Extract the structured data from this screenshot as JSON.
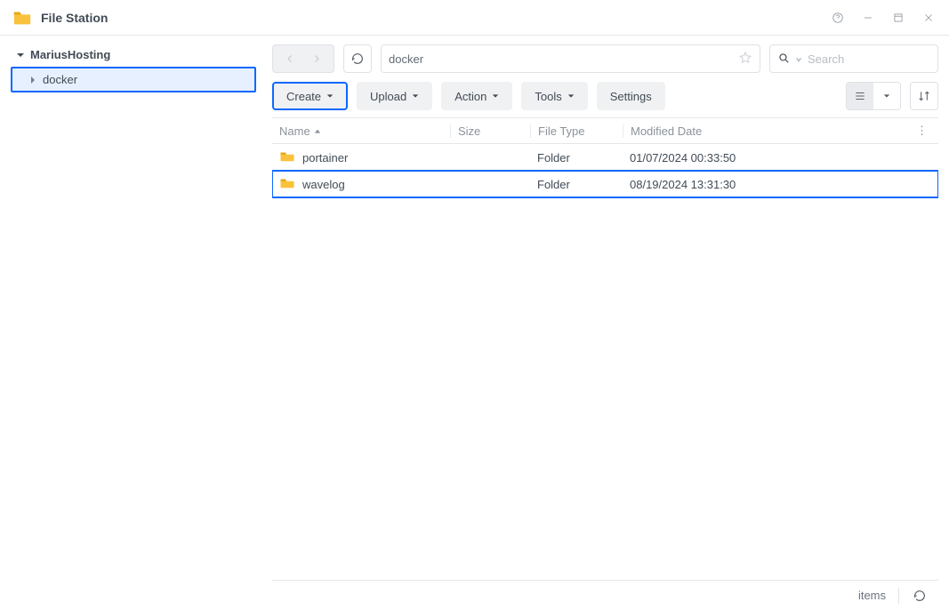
{
  "titlebar": {
    "title": "File Station"
  },
  "sidebar": {
    "root": {
      "label": "MariusHosting"
    },
    "child": {
      "label": "docker"
    }
  },
  "nav": {
    "path": "docker",
    "search_placeholder": "Search"
  },
  "toolbar": {
    "create": "Create",
    "upload": "Upload",
    "action": "Action",
    "tools": "Tools",
    "settings": "Settings"
  },
  "columns": {
    "name": "Name",
    "size": "Size",
    "type": "File Type",
    "date": "Modified Date"
  },
  "rows": [
    {
      "name": "portainer",
      "size": "",
      "type": "Folder",
      "date": "01/07/2024 00:33:50",
      "highlight": false
    },
    {
      "name": "wavelog",
      "size": "",
      "type": "Folder",
      "date": "08/19/2024 13:31:30",
      "highlight": true
    }
  ],
  "status": {
    "items": "items"
  }
}
